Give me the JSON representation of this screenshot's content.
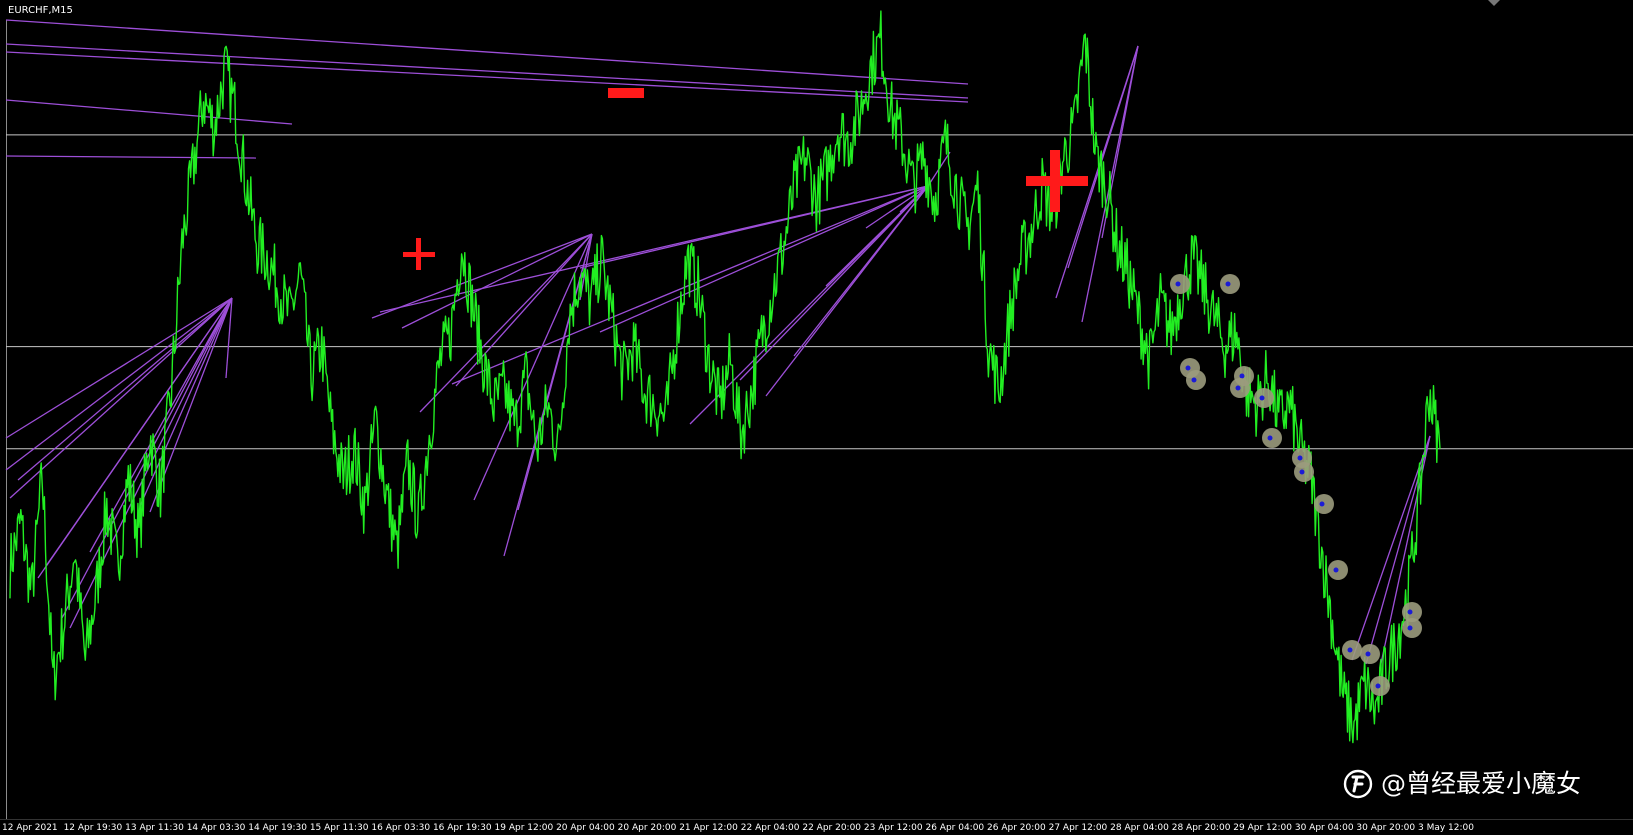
{
  "window": {
    "title": "EURCHF,M15"
  },
  "chart_data": {
    "type": "line",
    "symbol": "EURCHF",
    "timeframe": "M15",
    "x_labels": [
      "12 Apr 2021",
      "12 Apr 19:30",
      "13 Apr 11:30",
      "14 Apr 03:30",
      "14 Apr 19:30",
      "15 Apr 11:30",
      "16 Apr 03:30",
      "16 Apr 19:30",
      "19 Apr 12:00",
      "20 Apr 04:00",
      "20 Apr 20:00",
      "21 Apr 12:00",
      "22 Apr 04:00",
      "22 Apr 20:00",
      "23 Apr 12:00",
      "26 Apr 04:00",
      "26 Apr 20:00",
      "27 Apr 12:00",
      "28 Apr 04:00",
      "28 Apr 20:00",
      "29 Apr 12:00",
      "30 Apr 04:00",
      "30 Apr 20:00",
      "3 May 12:00"
    ],
    "series": [
      {
        "color": "#22ee22",
        "values": [
          0.28,
          0.34,
          0.24,
          0.4,
          0.12,
          0.2,
          0.3,
          0.15,
          0.24,
          0.36,
          0.28,
          0.4,
          0.32,
          0.46,
          0.38,
          0.52,
          0.72,
          0.82,
          0.92,
          0.88,
          0.96,
          0.9,
          0.8,
          0.72,
          0.7,
          0.66,
          0.62,
          0.68,
          0.54,
          0.58,
          0.46,
          0.4,
          0.44,
          0.36,
          0.48,
          0.38,
          0.3,
          0.42,
          0.34,
          0.46,
          0.56,
          0.6,
          0.72,
          0.64,
          0.56,
          0.5,
          0.52,
          0.47,
          0.54,
          0.44,
          0.5,
          0.44,
          0.62,
          0.68,
          0.64,
          0.7,
          0.62,
          0.54,
          0.58,
          0.52,
          0.5,
          0.48,
          0.6,
          0.7,
          0.66,
          0.56,
          0.5,
          0.56,
          0.46,
          0.52,
          0.6,
          0.66,
          0.72,
          0.8,
          0.84,
          0.78,
          0.82,
          0.88,
          0.86,
          0.9,
          0.96,
          1.0,
          0.9,
          0.86,
          0.8,
          0.84,
          0.78,
          0.86,
          0.8,
          0.74,
          0.8,
          0.58,
          0.52,
          0.62,
          0.7,
          0.74,
          0.8,
          0.76,
          0.84,
          0.88,
          1.0,
          0.84,
          0.8,
          0.72,
          0.68,
          0.62,
          0.56,
          0.64,
          0.6,
          0.66,
          0.7,
          0.66,
          0.62,
          0.58,
          0.6,
          0.52,
          0.5,
          0.54,
          0.48,
          0.5,
          0.44,
          0.4,
          0.3,
          0.2,
          0.1,
          0.06,
          0.12,
          0.08,
          0.14,
          0.18,
          0.24,
          0.36,
          0.52,
          0.44
        ]
      }
    ],
    "ylim": [
      0,
      1
    ],
    "horizontal_levels": [
      0.87,
      0.58,
      0.44
    ],
    "grid": false,
    "legend": "none",
    "colors": {
      "background": "#000000",
      "price_line": "#22ee22",
      "trend_lines": "#9d4fd8",
      "markers": "#ff1a1a",
      "horizontal_levels": "#c8c8c8",
      "circle_markers": "#9b9b7d",
      "circle_marker_dots": "#1b1bd6"
    }
  },
  "annotations": {
    "markers": [
      {
        "shape": "minus",
        "name": "sell-marker"
      },
      {
        "shape": "plus",
        "name": "buy-marker-small"
      },
      {
        "shape": "plus",
        "name": "buy-marker-large"
      }
    ]
  },
  "watermark": {
    "text": "@曾经最爱小魔女",
    "logo": "toutiao-logo-icon"
  }
}
